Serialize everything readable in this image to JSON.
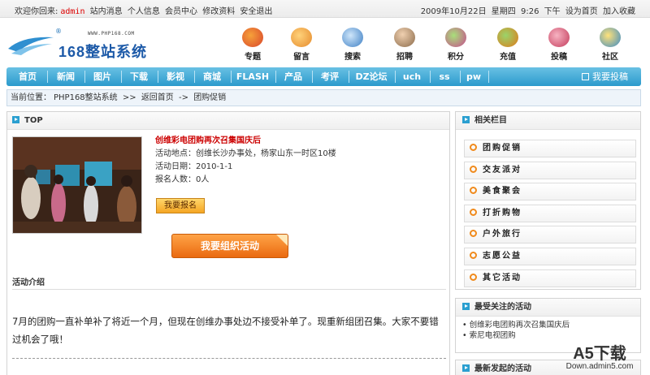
{
  "topbar": {
    "welcome": "欢迎你回来:",
    "username": "admin",
    "links": [
      "站内消息",
      "个人信息",
      "会员中心",
      "修改资料",
      "安全退出"
    ],
    "date": "2009年10月22日",
    "weekday": "星期四",
    "time": "9:26",
    "ampm": "下午",
    "set_home": "设为首页",
    "add_fav": "加入收藏"
  },
  "logo": {
    "url_text": "WWW.PHP168.COM",
    "name": "168整站系统",
    "trademark": "®"
  },
  "quick_links": [
    {
      "label": "专题",
      "icon": "topics-icon",
      "color": "#d9452b"
    },
    {
      "label": "留言",
      "icon": "message-icon",
      "color": "#e58a2c"
    },
    {
      "label": "搜索",
      "icon": "search-icon",
      "color": "#3d7fc4"
    },
    {
      "label": "招聘",
      "icon": "recruit-icon",
      "color": "#8a6a4a"
    },
    {
      "label": "积分",
      "icon": "points-icon",
      "color": "#c84a8f"
    },
    {
      "label": "充值",
      "icon": "recharge-icon",
      "color": "#e07a1a"
    },
    {
      "label": "投稿",
      "icon": "submit-icon",
      "color": "#c33a5a"
    },
    {
      "label": "社区",
      "icon": "community-icon",
      "color": "#3a8ac4"
    }
  ],
  "nav": {
    "items": [
      "首页",
      "新闻",
      "图片",
      "下载",
      "影视",
      "商城",
      "FLASH",
      "产品",
      "考评",
      "DZ论坛",
      "uch",
      "ss",
      "pw"
    ],
    "post_label": "我要投稿"
  },
  "breadcrumb": {
    "prefix": "当前位置：",
    "site": "PHP168整站系统",
    "sep1": ">>",
    "back": "返回首页",
    "sep2": "->",
    "current": "团购促销"
  },
  "main": {
    "header": "TOP",
    "event": {
      "title": "创维彩电团购再次召集国庆后",
      "location": "活动地点：创维长沙办事处，杨家山东一时区10楼",
      "date": "活动日期：2010-1-1",
      "signups": "报名人数：0人"
    },
    "signup_button": "我要报名",
    "organize_button": "我要组织活动",
    "intro_title": "活动介绍",
    "intro_text": "7月的团购一直补单补了将近一个月，但现在创维办事处边不接受补单了。现重新组团召集。大家不要错过机会了哦！"
  },
  "sidebar": {
    "related_title": "相关栏目",
    "related_items": [
      "团购促销",
      "交友派对",
      "美食聚会",
      "打折购物",
      "户外旅行",
      "志愿公益",
      "其它活动"
    ],
    "popular_title": "最受关注的活动",
    "popular_items": [
      "创维彩电团购再次召集国庆后",
      "索尼电视团购"
    ],
    "latest_title": "最新发起的活动"
  },
  "watermark": {
    "brand": "A5下载",
    "site": "Down.admin5.com"
  }
}
